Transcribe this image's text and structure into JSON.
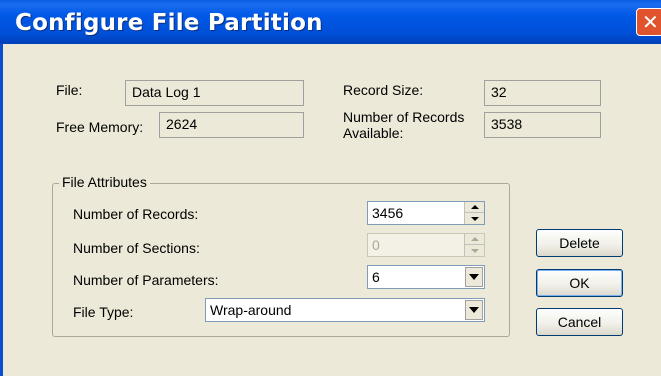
{
  "window": {
    "title": "Configure File Partition",
    "close_icon_text": "✕"
  },
  "file": {
    "label": "File:",
    "value": "Data Log 1"
  },
  "free_memory": {
    "label": "Free Memory:",
    "value": "2624"
  },
  "record_size": {
    "label": "Record Size:",
    "value": "32"
  },
  "records_available": {
    "label_line1": "Number of Records",
    "label_line2": "Available:",
    "value": "3538"
  },
  "file_attributes": {
    "title": "File Attributes",
    "number_of_records": {
      "label": "Number of Records:",
      "value": "3456"
    },
    "number_of_sections": {
      "label": "Number of Sections:",
      "value": "0",
      "enabled": false
    },
    "number_of_parameters": {
      "label": "Number of Parameters:",
      "value": "6"
    },
    "file_type": {
      "label": "File Type:",
      "value": "Wrap-around"
    }
  },
  "buttons": {
    "delete": "Delete",
    "ok": "OK",
    "cancel": "Cancel"
  }
}
